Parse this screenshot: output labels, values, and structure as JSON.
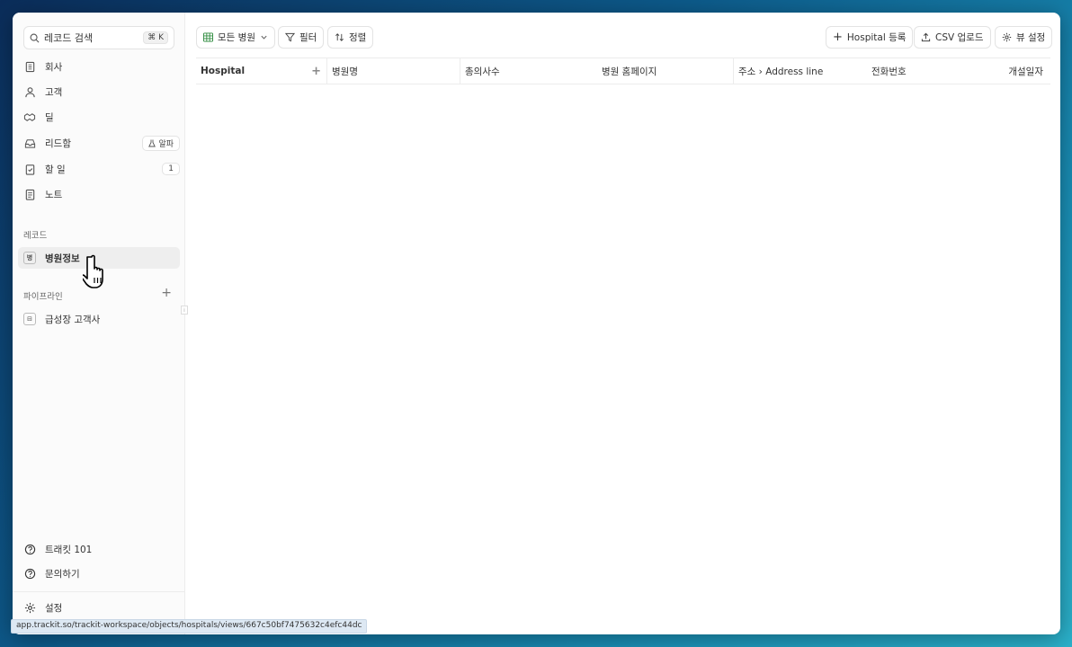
{
  "sidebar": {
    "search": {
      "label": "레코드 검색",
      "shortcut": "⌘ K"
    },
    "items": [
      {
        "label": "회사",
        "icon": "building-icon"
      },
      {
        "label": "고객",
        "icon": "user-icon"
      },
      {
        "label": "딜",
        "icon": "handshake-icon"
      },
      {
        "label": "리드함",
        "icon": "inbox-icon",
        "badge": "알파",
        "badge_icon": "flask-icon"
      },
      {
        "label": "할 일",
        "icon": "clipboard-check-icon",
        "badge": "1"
      },
      {
        "label": "노트",
        "icon": "notes-icon"
      }
    ],
    "records_label": "레코드",
    "records": [
      {
        "label": "병원정보",
        "icon_text": "병"
      }
    ],
    "pipeline_label": "파이프라인",
    "pipelines": [
      {
        "label": "급성장 고객사"
      }
    ],
    "footer": [
      {
        "label": "트래킷 101",
        "icon": "help-circle-icon"
      },
      {
        "label": "문의하기",
        "icon": "help-circle-icon"
      },
      {
        "label": "설정",
        "icon": "gear-icon"
      }
    ]
  },
  "toolbar": {
    "view_label": "모든 병원",
    "filter_label": "필터",
    "sort_label": "정렬",
    "add_label": "Hospital 등록",
    "csv_label": "CSV 업로드",
    "view_settings_label": "뷰 설정"
  },
  "table": {
    "columns": [
      "Hospital",
      "병원명",
      "총의사수",
      "병원 홈페이지",
      "주소 › Address line",
      "전화번호",
      "개설일자"
    ],
    "rows": []
  },
  "status_url": "app.trackit.so/trackit-workspace/objects/hospitals/views/667c50bf7475632c4efc44dc",
  "colors": {
    "accent_bg": "#eeeeee",
    "background_gradient_start": "#0b2d5a",
    "background_gradient_end": "#2bb0c9"
  }
}
